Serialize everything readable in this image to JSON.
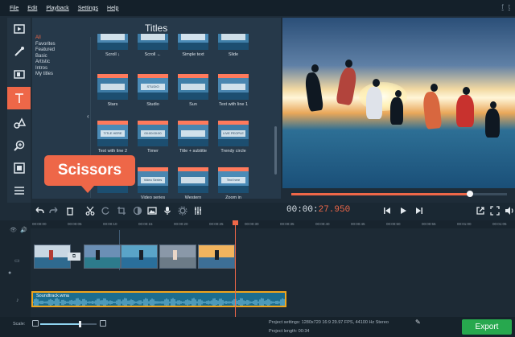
{
  "menu": [
    "File",
    "Edit",
    "Playback",
    "Settings",
    "Help"
  ],
  "social": {
    "icons": [
      "facebook-icon",
      "twitter-icon"
    ],
    "facebook": "f",
    "twitter": "t"
  },
  "toolstrip": {
    "items": [
      "import-icon",
      "filters-icon",
      "transitions-icon",
      "titles-icon",
      "stickers-icon",
      "zoom-icon",
      "chroma-key-icon",
      "more-tools-icon"
    ],
    "active": "titles-icon",
    "active_color": "#ee6748"
  },
  "library": {
    "title": "Titles",
    "categories": [
      "All",
      "Favorites",
      "Featured",
      "Basic",
      "Artistic",
      "Intros",
      "My titles"
    ],
    "selected_category": "All",
    "tiles": [
      {
        "label": "Scroll ↓"
      },
      {
        "label": "Scroll ←"
      },
      {
        "label": "Simple text"
      },
      {
        "label": "Slide"
      },
      {
        "label": "Stars",
        "text": ""
      },
      {
        "label": "Studio",
        "text": "STUDIO"
      },
      {
        "label": "Sun",
        "text": ""
      },
      {
        "label": "Text with line 1",
        "text": ""
      },
      {
        "label": "Text with line 2",
        "text": "TITLE HERE"
      },
      {
        "label": "Timer",
        "text": "00:00:00:00"
      },
      {
        "label": "Title + subtitle",
        "text": ""
      },
      {
        "label": "Trendy circle",
        "text": "LIVE PEOPLE LIVE"
      },
      {
        "label": "",
        "text": ""
      },
      {
        "label": "Video series",
        "text": "Video Series"
      },
      {
        "label": "Western",
        "text": ""
      },
      {
        "label": "Zoom in",
        "text": "Text here"
      }
    ]
  },
  "tooltip": "Scissors",
  "toolbar": {
    "buttons": [
      "undo-icon",
      "redo-icon",
      "delete-icon",
      "scissors-icon",
      "rotate-icon",
      "crop-icon",
      "color-adjust-icon",
      "image-icon",
      "audio-icon",
      "settings-icon",
      "equalizer-icon"
    ],
    "timecode_prefix": "00:00:",
    "timecode_value": "27.950",
    "transport": [
      "skip-back-icon",
      "play-icon",
      "skip-forward-icon"
    ],
    "right": [
      "export-view-icon",
      "fullscreen-icon",
      "volume-icon"
    ]
  },
  "preview": {
    "progress": 0.83
  },
  "timeline": {
    "ticks": [
      "00:00:00",
      "00:00:05",
      "00:00:10",
      "00:00:15",
      "00:00:20",
      "00:00:25",
      "00:00:30",
      "00:00:35",
      "00:00:40",
      "00:00:45",
      "00:00:50",
      "00:00:55",
      "00:01:00",
      "00:01:05"
    ],
    "audio_label": "Soundtrack.wma",
    "transition_label": "⧉",
    "playhead_time": "00:00:27.950"
  },
  "status": {
    "scale_label": "Scale:",
    "scale_value": 0.7,
    "project_settings": "Project settings:  1280x720 16:9 29.97 FPS, 44100 Hz Stereo",
    "project_length": "Project length:   00:34",
    "export_label": "Export"
  },
  "colors": {
    "accent": "#ee6748",
    "export": "#27a84e",
    "audio_border": "#f0a51c",
    "audio_fill": "#1b6d8f"
  }
}
